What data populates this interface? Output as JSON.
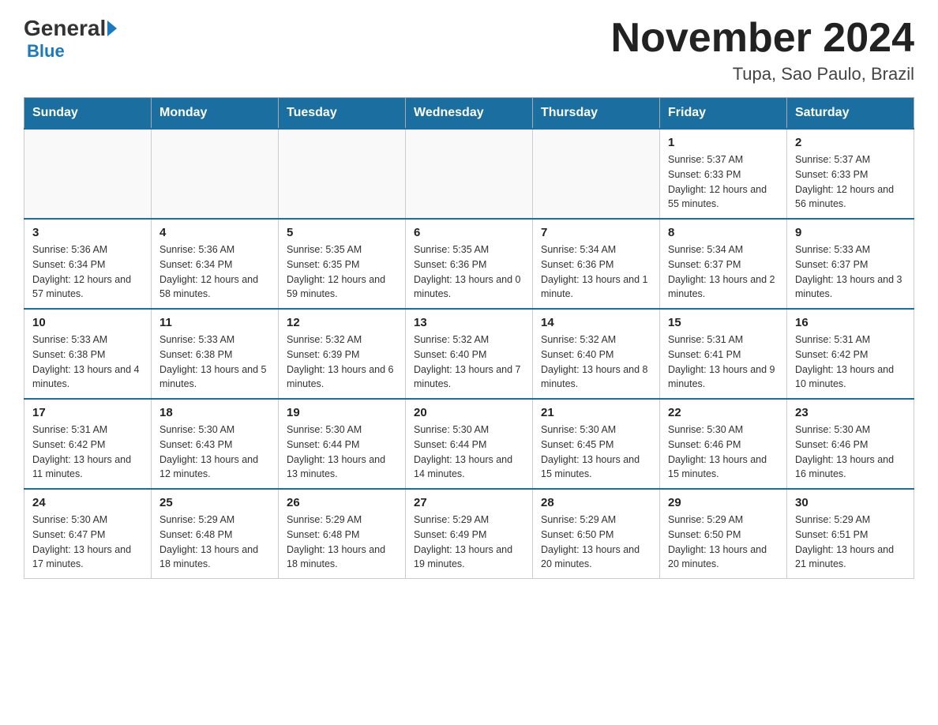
{
  "header": {
    "logo_general": "General",
    "logo_blue": "Blue",
    "month_title": "November 2024",
    "location": "Tupa, Sao Paulo, Brazil"
  },
  "days_of_week": [
    "Sunday",
    "Monday",
    "Tuesday",
    "Wednesday",
    "Thursday",
    "Friday",
    "Saturday"
  ],
  "weeks": [
    [
      {
        "day": "",
        "sunrise": "",
        "sunset": "",
        "daylight": ""
      },
      {
        "day": "",
        "sunrise": "",
        "sunset": "",
        "daylight": ""
      },
      {
        "day": "",
        "sunrise": "",
        "sunset": "",
        "daylight": ""
      },
      {
        "day": "",
        "sunrise": "",
        "sunset": "",
        "daylight": ""
      },
      {
        "day": "",
        "sunrise": "",
        "sunset": "",
        "daylight": ""
      },
      {
        "day": "1",
        "sunrise": "Sunrise: 5:37 AM",
        "sunset": "Sunset: 6:33 PM",
        "daylight": "Daylight: 12 hours and 55 minutes."
      },
      {
        "day": "2",
        "sunrise": "Sunrise: 5:37 AM",
        "sunset": "Sunset: 6:33 PM",
        "daylight": "Daylight: 12 hours and 56 minutes."
      }
    ],
    [
      {
        "day": "3",
        "sunrise": "Sunrise: 5:36 AM",
        "sunset": "Sunset: 6:34 PM",
        "daylight": "Daylight: 12 hours and 57 minutes."
      },
      {
        "day": "4",
        "sunrise": "Sunrise: 5:36 AM",
        "sunset": "Sunset: 6:34 PM",
        "daylight": "Daylight: 12 hours and 58 minutes."
      },
      {
        "day": "5",
        "sunrise": "Sunrise: 5:35 AM",
        "sunset": "Sunset: 6:35 PM",
        "daylight": "Daylight: 12 hours and 59 minutes."
      },
      {
        "day": "6",
        "sunrise": "Sunrise: 5:35 AM",
        "sunset": "Sunset: 6:36 PM",
        "daylight": "Daylight: 13 hours and 0 minutes."
      },
      {
        "day": "7",
        "sunrise": "Sunrise: 5:34 AM",
        "sunset": "Sunset: 6:36 PM",
        "daylight": "Daylight: 13 hours and 1 minute."
      },
      {
        "day": "8",
        "sunrise": "Sunrise: 5:34 AM",
        "sunset": "Sunset: 6:37 PM",
        "daylight": "Daylight: 13 hours and 2 minutes."
      },
      {
        "day": "9",
        "sunrise": "Sunrise: 5:33 AM",
        "sunset": "Sunset: 6:37 PM",
        "daylight": "Daylight: 13 hours and 3 minutes."
      }
    ],
    [
      {
        "day": "10",
        "sunrise": "Sunrise: 5:33 AM",
        "sunset": "Sunset: 6:38 PM",
        "daylight": "Daylight: 13 hours and 4 minutes."
      },
      {
        "day": "11",
        "sunrise": "Sunrise: 5:33 AM",
        "sunset": "Sunset: 6:38 PM",
        "daylight": "Daylight: 13 hours and 5 minutes."
      },
      {
        "day": "12",
        "sunrise": "Sunrise: 5:32 AM",
        "sunset": "Sunset: 6:39 PM",
        "daylight": "Daylight: 13 hours and 6 minutes."
      },
      {
        "day": "13",
        "sunrise": "Sunrise: 5:32 AM",
        "sunset": "Sunset: 6:40 PM",
        "daylight": "Daylight: 13 hours and 7 minutes."
      },
      {
        "day": "14",
        "sunrise": "Sunrise: 5:32 AM",
        "sunset": "Sunset: 6:40 PM",
        "daylight": "Daylight: 13 hours and 8 minutes."
      },
      {
        "day": "15",
        "sunrise": "Sunrise: 5:31 AM",
        "sunset": "Sunset: 6:41 PM",
        "daylight": "Daylight: 13 hours and 9 minutes."
      },
      {
        "day": "16",
        "sunrise": "Sunrise: 5:31 AM",
        "sunset": "Sunset: 6:42 PM",
        "daylight": "Daylight: 13 hours and 10 minutes."
      }
    ],
    [
      {
        "day": "17",
        "sunrise": "Sunrise: 5:31 AM",
        "sunset": "Sunset: 6:42 PM",
        "daylight": "Daylight: 13 hours and 11 minutes."
      },
      {
        "day": "18",
        "sunrise": "Sunrise: 5:30 AM",
        "sunset": "Sunset: 6:43 PM",
        "daylight": "Daylight: 13 hours and 12 minutes."
      },
      {
        "day": "19",
        "sunrise": "Sunrise: 5:30 AM",
        "sunset": "Sunset: 6:44 PM",
        "daylight": "Daylight: 13 hours and 13 minutes."
      },
      {
        "day": "20",
        "sunrise": "Sunrise: 5:30 AM",
        "sunset": "Sunset: 6:44 PM",
        "daylight": "Daylight: 13 hours and 14 minutes."
      },
      {
        "day": "21",
        "sunrise": "Sunrise: 5:30 AM",
        "sunset": "Sunset: 6:45 PM",
        "daylight": "Daylight: 13 hours and 15 minutes."
      },
      {
        "day": "22",
        "sunrise": "Sunrise: 5:30 AM",
        "sunset": "Sunset: 6:46 PM",
        "daylight": "Daylight: 13 hours and 15 minutes."
      },
      {
        "day": "23",
        "sunrise": "Sunrise: 5:30 AM",
        "sunset": "Sunset: 6:46 PM",
        "daylight": "Daylight: 13 hours and 16 minutes."
      }
    ],
    [
      {
        "day": "24",
        "sunrise": "Sunrise: 5:30 AM",
        "sunset": "Sunset: 6:47 PM",
        "daylight": "Daylight: 13 hours and 17 minutes."
      },
      {
        "day": "25",
        "sunrise": "Sunrise: 5:29 AM",
        "sunset": "Sunset: 6:48 PM",
        "daylight": "Daylight: 13 hours and 18 minutes."
      },
      {
        "day": "26",
        "sunrise": "Sunrise: 5:29 AM",
        "sunset": "Sunset: 6:48 PM",
        "daylight": "Daylight: 13 hours and 18 minutes."
      },
      {
        "day": "27",
        "sunrise": "Sunrise: 5:29 AM",
        "sunset": "Sunset: 6:49 PM",
        "daylight": "Daylight: 13 hours and 19 minutes."
      },
      {
        "day": "28",
        "sunrise": "Sunrise: 5:29 AM",
        "sunset": "Sunset: 6:50 PM",
        "daylight": "Daylight: 13 hours and 20 minutes."
      },
      {
        "day": "29",
        "sunrise": "Sunrise: 5:29 AM",
        "sunset": "Sunset: 6:50 PM",
        "daylight": "Daylight: 13 hours and 20 minutes."
      },
      {
        "day": "30",
        "sunrise": "Sunrise: 5:29 AM",
        "sunset": "Sunset: 6:51 PM",
        "daylight": "Daylight: 13 hours and 21 minutes."
      }
    ]
  ]
}
